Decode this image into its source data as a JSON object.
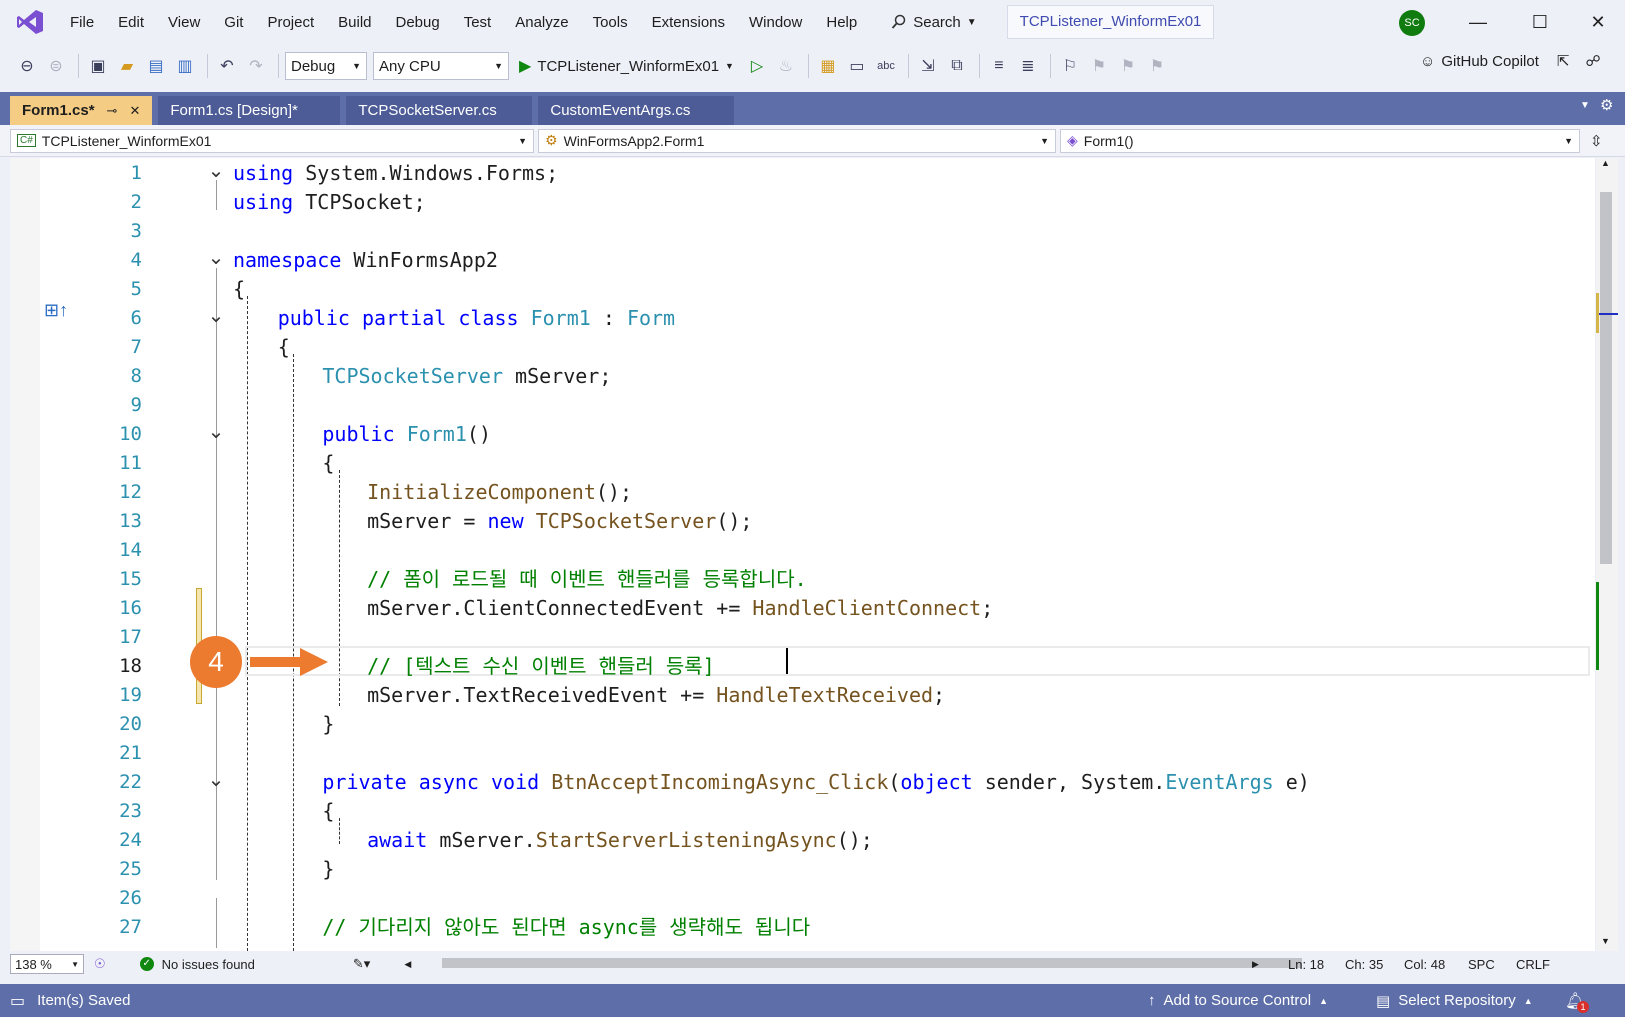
{
  "menu": [
    "File",
    "Edit",
    "View",
    "Git",
    "Project",
    "Build",
    "Debug",
    "Test",
    "Analyze",
    "Tools",
    "Extensions",
    "Window",
    "Help"
  ],
  "search_label": "Search",
  "solution_title": "TCPListener_WinformEx01",
  "avatar_initials": "SC",
  "toolbar": {
    "config": "Debug",
    "platform": "Any CPU",
    "run_target": "TCPListener_WinformEx01",
    "copilot": "GitHub Copilot"
  },
  "tabs": [
    {
      "label": "Form1.cs*",
      "active": true
    },
    {
      "label": "Form1.cs [Design]*",
      "active": false
    },
    {
      "label": "TCPSocketServer.cs",
      "active": false
    },
    {
      "label": "CustomEventArgs.cs",
      "active": false
    }
  ],
  "nav": {
    "project": "TCPListener_WinformEx01",
    "class": "WinFormsApp2.Form1",
    "member": "Form1()"
  },
  "editor": {
    "current_line": 18,
    "annotation_number": "4",
    "lines": [
      {
        "n": "1",
        "t": "using System.Windows.Forms;"
      },
      {
        "n": "2",
        "t": "using TCPSocket;"
      },
      {
        "n": "3",
        "t": ""
      },
      {
        "n": "4",
        "t": "namespace WinFormsApp2"
      },
      {
        "n": "5",
        "t": "{"
      },
      {
        "n": "6",
        "t": "public partial class Form1 : Form"
      },
      {
        "n": "7",
        "t": "{"
      },
      {
        "n": "8",
        "t": "TCPSocketServer mServer;"
      },
      {
        "n": "9",
        "t": ""
      },
      {
        "n": "10",
        "t": "public Form1()"
      },
      {
        "n": "11",
        "t": "{"
      },
      {
        "n": "12",
        "t": "InitializeComponent();"
      },
      {
        "n": "13",
        "t": "mServer = new TCPSocketServer();"
      },
      {
        "n": "14",
        "t": ""
      },
      {
        "n": "15",
        "t": "// 폼이 로드될 때 이벤트 핸들러를 등록합니다."
      },
      {
        "n": "16",
        "t": "mServer.ClientConnectedEvent += HandleClientConnect;"
      },
      {
        "n": "17",
        "t": ""
      },
      {
        "n": "18",
        "t": "// [텍스트 수신 이벤트 핸들러 등록]"
      },
      {
        "n": "19",
        "t": "mServer.TextReceivedEvent += HandleTextReceived;"
      },
      {
        "n": "20",
        "t": "}"
      },
      {
        "n": "21",
        "t": ""
      },
      {
        "n": "22",
        "t": "private async void BtnAcceptIncomingAsync_Click(object sender, System.EventArgs e)"
      },
      {
        "n": "23",
        "t": "{"
      },
      {
        "n": "24",
        "t": "await mServer.StartServerListeningAsync();"
      },
      {
        "n": "25",
        "t": "}"
      },
      {
        "n": "26",
        "t": ""
      },
      {
        "n": "27",
        "t": "// 기다리지 않아도 된다면 async를 생략해도 됩니다"
      }
    ]
  },
  "editor_status": {
    "zoom": "138 %",
    "issues": "No issues found",
    "ln": "Ln: 18",
    "ch": "Ch: 35",
    "col": "Col: 48",
    "spc": "SPC",
    "crlf": "CRLF"
  },
  "statusbar": {
    "message": "Item(s) Saved",
    "source_control": "Add to Source Control",
    "repository": "Select Repository",
    "notification_count": "1"
  },
  "colors": {
    "keyword": "#0000ff",
    "type": "#2b91af",
    "method": "#74531f",
    "comment": "#008000",
    "accent_tab": "#f5cc84",
    "statusbar": "#5e6ea8",
    "annotation": "#ec7b2f"
  }
}
